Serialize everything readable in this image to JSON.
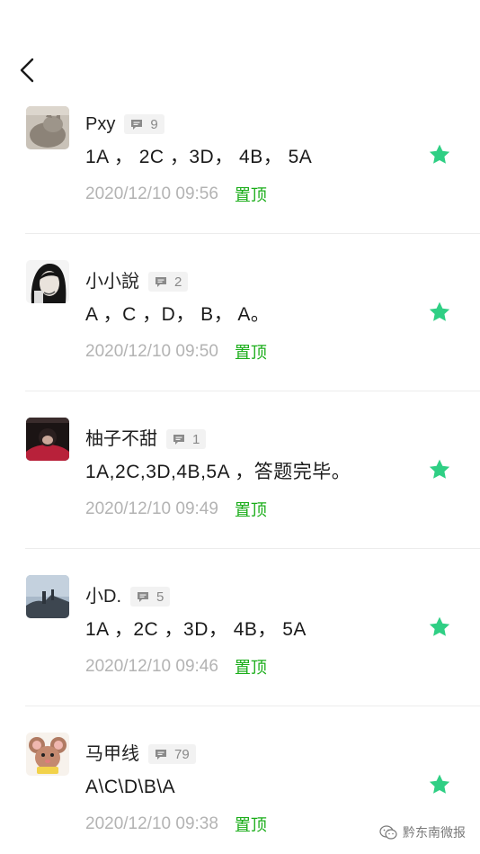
{
  "colors": {
    "accent_green": "#1aad19",
    "star_green": "#2fcf84",
    "time_gray": "#b3b3b3"
  },
  "icons": {
    "back": "chevron-left-icon",
    "comment": "comment-bubble-icon",
    "star": "star-icon",
    "watermark": "wechat-icon"
  },
  "comments": [
    {
      "name": "Pxy",
      "reply_count": "9",
      "text": "1A ， 2C ，3D， 4B， 5A",
      "time": "2020/12/10 09:56",
      "pin_label": "置顶",
      "starred": true
    },
    {
      "name": "小小說",
      "reply_count": "2",
      "text": "A ，C ，D， B， A。",
      "time": "2020/12/10 09:50",
      "pin_label": "置顶",
      "starred": true
    },
    {
      "name": "柚子不甜",
      "reply_count": "1",
      "text": "1A,2C,3D,4B,5A ，答题完毕。",
      "time": "2020/12/10 09:49",
      "pin_label": "置顶",
      "starred": true
    },
    {
      "name": "小D.",
      "reply_count": "5",
      "text": "1A ，2C ，3D， 4B， 5A",
      "time": "2020/12/10 09:46",
      "pin_label": "置顶",
      "starred": true
    },
    {
      "name": "马甲线",
      "reply_count": "79",
      "text": "A\\C\\D\\B\\A",
      "time": "2020/12/10 09:38",
      "pin_label": "置顶",
      "starred": true
    }
  ],
  "watermark": {
    "text": "黔东南微报"
  }
}
